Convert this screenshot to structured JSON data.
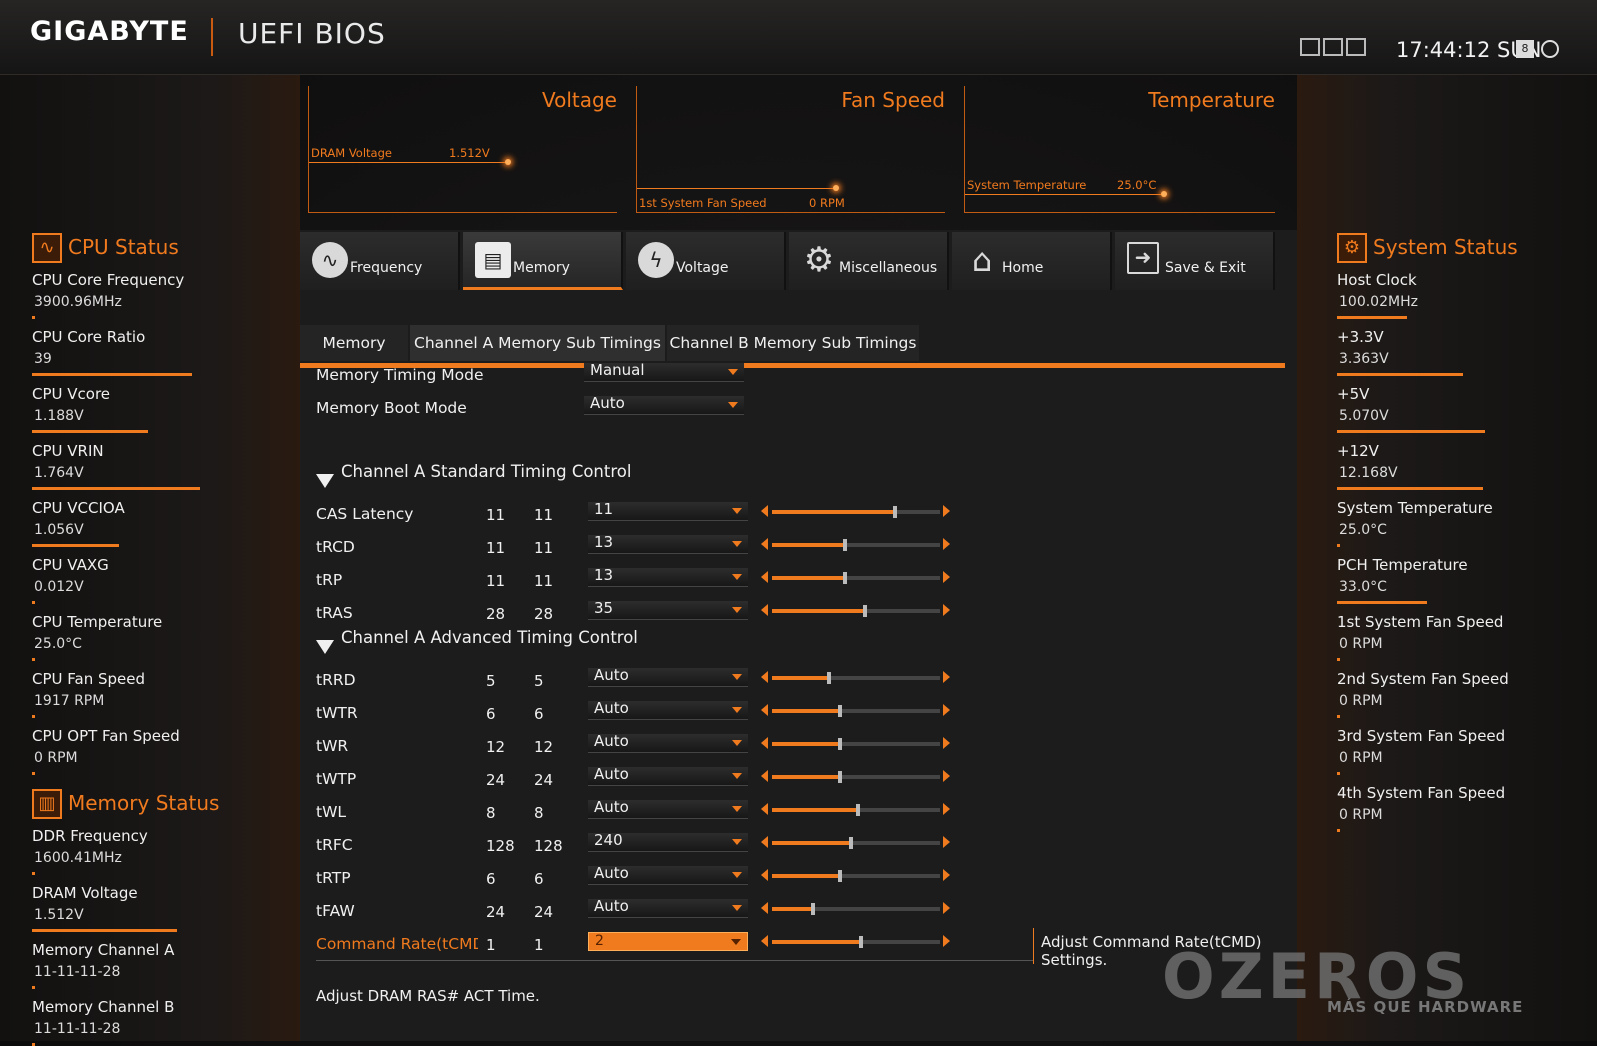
{
  "header": {
    "brand": "GIGABYTE",
    "product": "UEFI BIOS",
    "clock": "17:44:12 SUN"
  },
  "monitor": {
    "voltage": {
      "title": "Voltage",
      "label": "DRAM Voltage",
      "value": "1.512V"
    },
    "fan": {
      "title": "Fan Speed",
      "label": "1st System Fan Speed",
      "value": "0 RPM"
    },
    "temp": {
      "title": "Temperature",
      "label": "System Temperature",
      "value": "25.0°C"
    }
  },
  "tabs": [
    {
      "label": "Frequency",
      "icon": "frequency-icon"
    },
    {
      "label": "Memory",
      "icon": "memory-icon"
    },
    {
      "label": "Voltage",
      "icon": "voltage-icon"
    },
    {
      "label": "Miscellaneous",
      "icon": "gear-icon"
    },
    {
      "label": "Home",
      "icon": "home-icon"
    },
    {
      "label": "Save & Exit",
      "icon": "exit-icon"
    }
  ],
  "subtabs": [
    "Memory",
    "Channel A Memory Sub Timings",
    "Channel B Memory Sub Timings"
  ],
  "cpu_status": {
    "title": "CPU Status",
    "items": [
      {
        "label": "CPU Core Frequency",
        "value": "3900.96MHz",
        "bar": 0.0
      },
      {
        "label": "CPU Core Ratio",
        "value": "39",
        "bar": 0.55
      },
      {
        "label": "CPU Vcore",
        "value": "1.188V",
        "bar": 0.4
      },
      {
        "label": "CPU VRIN",
        "value": "1.764V",
        "bar": 0.58
      },
      {
        "label": "CPU VCCIOA",
        "value": "1.056V",
        "bar": 0.3
      },
      {
        "label": "CPU VAXG",
        "value": "0.012V",
        "bar": 0.01
      },
      {
        "label": "CPU Temperature",
        "value": "25.0°C",
        "bar": 0.0
      },
      {
        "label": "CPU Fan Speed",
        "value": "1917 RPM",
        "bar": 0.0
      },
      {
        "label": "CPU OPT Fan Speed",
        "value": "0 RPM",
        "bar": 0.01
      }
    ]
  },
  "memory_status": {
    "title": "Memory Status",
    "items": [
      {
        "label": "DDR Frequency",
        "value": "1600.41MHz",
        "bar": 0.0
      },
      {
        "label": "DRAM Voltage",
        "value": "1.512V",
        "bar": 0.5
      },
      {
        "label": "Memory Channel A",
        "value": "11-11-11-28",
        "bar": 0.0
      },
      {
        "label": "Memory Channel B",
        "value": "11-11-11-28",
        "bar": 0.0
      }
    ]
  },
  "system_status": {
    "title": "System Status",
    "items": [
      {
        "label": "Host Clock",
        "value": "100.02MHz",
        "bar": 0.25
      },
      {
        "label": "+3.3V",
        "value": "3.363V",
        "bar": 0.45
      },
      {
        "label": "+5V",
        "value": "5.070V",
        "bar": 0.53
      },
      {
        "label": "+12V",
        "value": "12.168V",
        "bar": 0.52
      },
      {
        "label": "System Temperature",
        "value": "25.0°C",
        "bar": 0.0
      },
      {
        "label": "PCH Temperature",
        "value": "33.0°C",
        "bar": 0.32
      },
      {
        "label": "1st System Fan Speed",
        "value": "0 RPM",
        "bar": 0.0
      },
      {
        "label": "2nd System Fan Speed",
        "value": "0 RPM",
        "bar": 0.0
      },
      {
        "label": "3rd System Fan Speed",
        "value": "0 RPM",
        "bar": 0.0
      },
      {
        "label": "4th System Fan Speed",
        "value": "0 RPM",
        "bar": 0.0
      }
    ]
  },
  "settings": {
    "timing_mode": {
      "label": "Memory Timing Mode",
      "value": "Manual"
    },
    "boot_mode": {
      "label": "Memory Boot Mode",
      "value": "Auto"
    },
    "standard_title": "Channel A Standard Timing Control",
    "advanced_title": "Channel A Advanced Timing Control",
    "standard": [
      {
        "label": "CAS Latency",
        "a": "11",
        "b": "11",
        "value": "11",
        "fill": 0.72
      },
      {
        "label": "tRCD",
        "a": "11",
        "b": "11",
        "value": "13",
        "fill": 0.42
      },
      {
        "label": "tRP",
        "a": "11",
        "b": "11",
        "value": "13",
        "fill": 0.42
      },
      {
        "label": "tRAS",
        "a": "28",
        "b": "28",
        "value": "35",
        "fill": 0.54
      }
    ],
    "advanced": [
      {
        "label": "tRRD",
        "a": "5",
        "b": "5",
        "value": "Auto",
        "fill": 0.33
      },
      {
        "label": "tWTR",
        "a": "6",
        "b": "6",
        "value": "Auto",
        "fill": 0.39
      },
      {
        "label": "tWR",
        "a": "12",
        "b": "12",
        "value": "Auto",
        "fill": 0.39
      },
      {
        "label": "tWTP",
        "a": "24",
        "b": "24",
        "value": "Auto",
        "fill": 0.39
      },
      {
        "label": "tWL",
        "a": "8",
        "b": "8",
        "value": "Auto",
        "fill": 0.5
      },
      {
        "label": "tRFC",
        "a": "128",
        "b": "128",
        "value": "240",
        "fill": 0.46
      },
      {
        "label": "tRTP",
        "a": "6",
        "b": "6",
        "value": "Auto",
        "fill": 0.39
      },
      {
        "label": "tFAW",
        "a": "24",
        "b": "24",
        "value": "Auto",
        "fill": 0.23
      },
      {
        "label": "Command Rate(tCMD)",
        "a": "1",
        "b": "1",
        "value": "2",
        "fill": 0.52,
        "highlight": true
      }
    ]
  },
  "help": {
    "side": "Adjust Command Rate(tCMD) Settings.",
    "bottom": "Adjust DRAM RAS# ACT Time."
  },
  "watermark": {
    "main": "OZEROS",
    "sub": "MÁS QUE HARDWARE"
  },
  "colors": {
    "accent": "#f07a1e",
    "background": "#1c1c1c"
  }
}
